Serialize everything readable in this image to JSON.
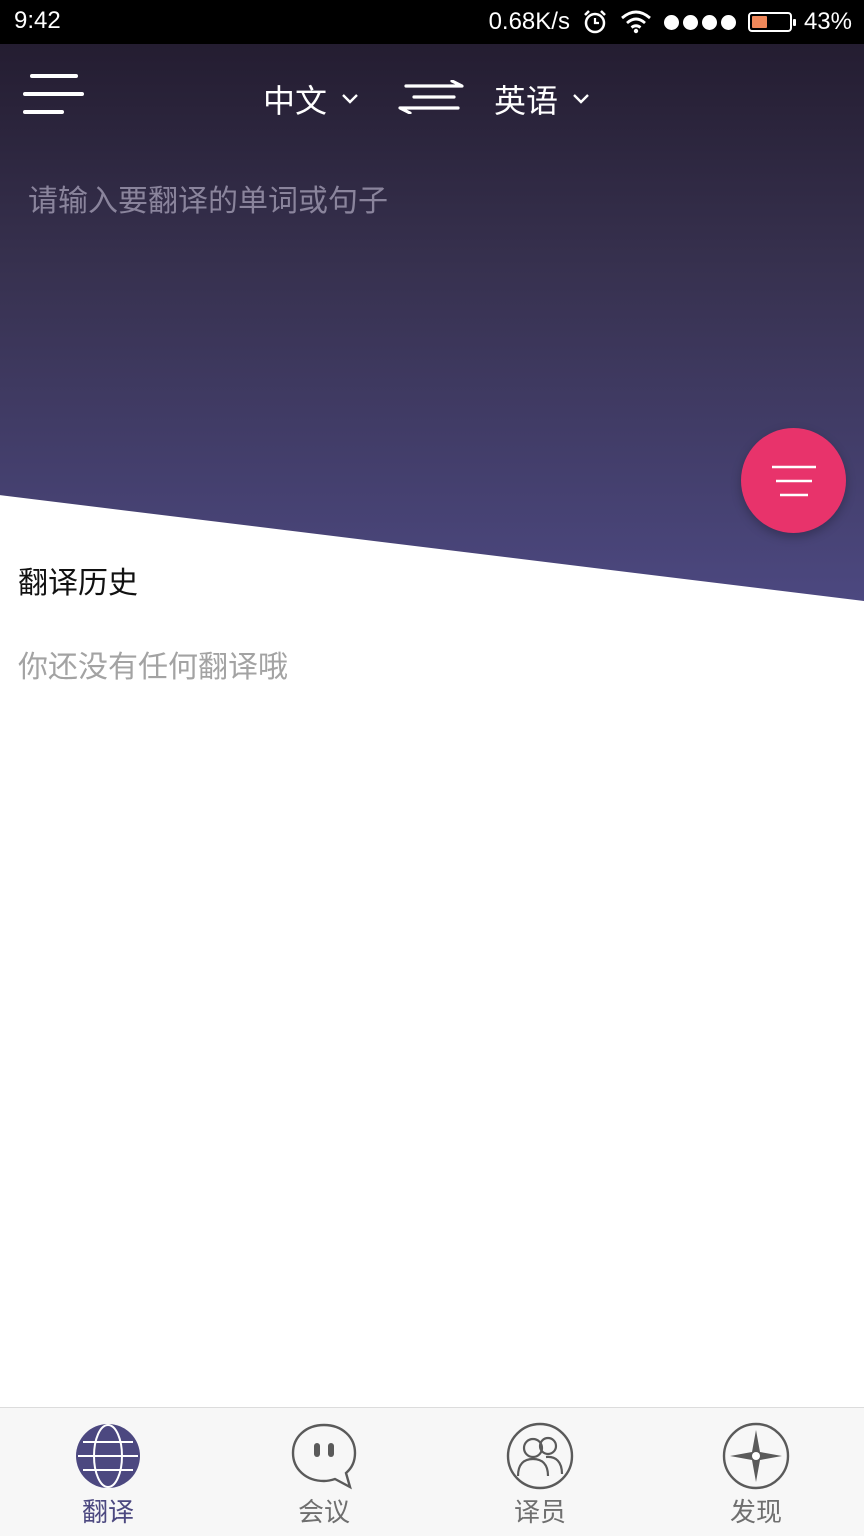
{
  "status_bar": {
    "time": "9:42",
    "network_speed": "0.68K/s",
    "battery_percent": "43%",
    "battery_level": 0.43,
    "icons": [
      "alarm-icon",
      "wifi-icon",
      "signal-icon",
      "battery-icon"
    ]
  },
  "header": {
    "source_language": "中文",
    "target_language": "英语",
    "icons": [
      "menu-icon",
      "chevron-down-icon",
      "swap-icon"
    ]
  },
  "translate_input": {
    "placeholder": "请输入要翻译的单词或句子",
    "value": ""
  },
  "fab": {
    "icon": "menu-lines-icon",
    "color": "#e8336b"
  },
  "history": {
    "title": "翻译历史",
    "empty_text": "你还没有任何翻译哦"
  },
  "tabs": [
    {
      "label": "翻译",
      "icon": "globe-icon",
      "active": true
    },
    {
      "label": "会议",
      "icon": "chat-bubble-icon",
      "active": false
    },
    {
      "label": "译员",
      "icon": "people-icon",
      "active": false
    },
    {
      "label": "发现",
      "icon": "compass-icon",
      "active": false
    }
  ],
  "colors": {
    "accent": "#4c4880",
    "header_top": "#241d31",
    "header_bottom": "#4c4880",
    "fab": "#e8336b"
  }
}
